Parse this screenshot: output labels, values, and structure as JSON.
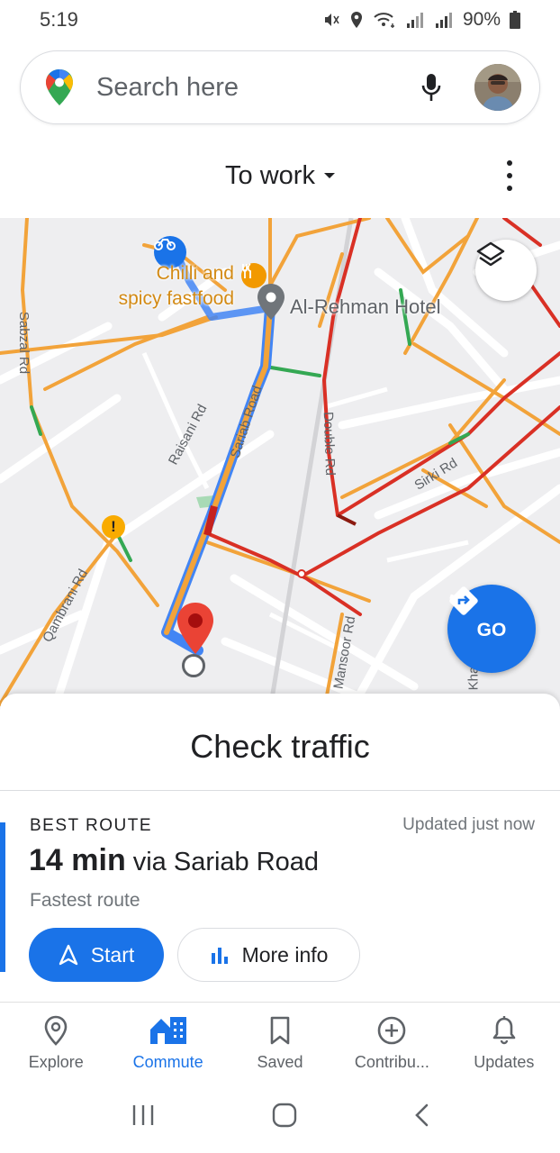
{
  "status": {
    "time": "5:19",
    "battery": "90%"
  },
  "search": {
    "placeholder": "Search here"
  },
  "commute": {
    "title": "To work"
  },
  "map": {
    "poi_name_line1": "Chilli and",
    "poi_name_line2": "spicy fastfood",
    "hotel_name": "Al-Rehman Hotel",
    "roads": {
      "sabzal": "Sabzal Rd",
      "raisani": "Raisani Rd",
      "sariab": "Sariab Road",
      "double": "Double Rd",
      "sirki": "Sirki Rd",
      "qambrani": "Qambrani Rd",
      "mansoor": "Mansoor Rd",
      "khar": "Khar"
    },
    "go_label": "GO",
    "colors": {
      "route": "#f2a33a",
      "traffic_red": "#d93025",
      "traffic_orange": "#f29900",
      "traffic_green": "#34a853",
      "route_blue": "#4285f4"
    }
  },
  "sheet": {
    "check_traffic": "Check traffic",
    "best_route": "BEST ROUTE",
    "updated": "Updated just now",
    "time": "14 min",
    "via": "via Sariab Road",
    "sub": "Fastest route",
    "start_label": "Start",
    "more_info_label": "More info"
  },
  "nav": {
    "items": [
      {
        "label": "Explore",
        "icon": "location-pin-icon"
      },
      {
        "label": "Commute",
        "icon": "commute-icon"
      },
      {
        "label": "Saved",
        "icon": "bookmark-icon"
      },
      {
        "label": "Contribu...",
        "icon": "add-circle-icon"
      },
      {
        "label": "Updates",
        "icon": "bell-icon"
      }
    ],
    "active": "Commute"
  }
}
